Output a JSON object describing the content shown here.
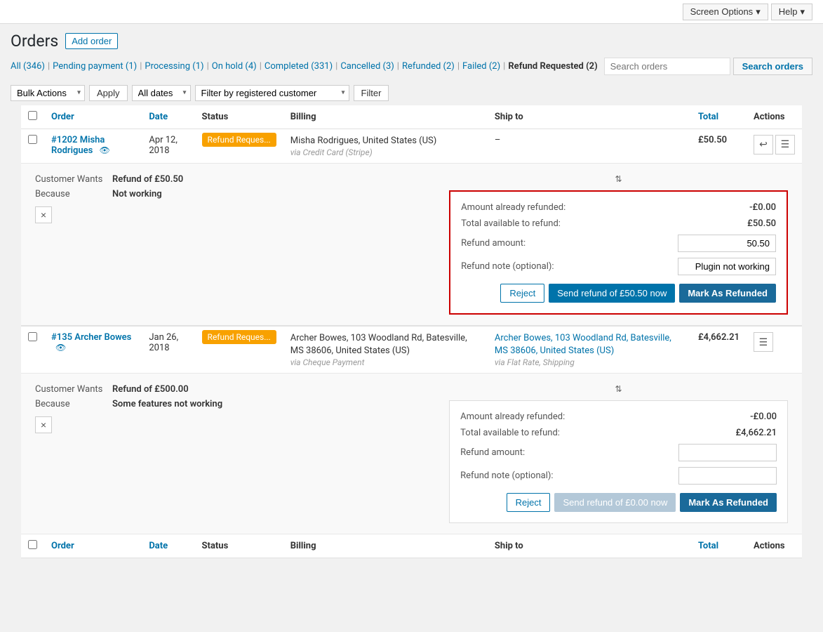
{
  "topbar": {
    "screen_options_label": "Screen Options",
    "help_label": "Help"
  },
  "header": {
    "title": "Orders",
    "add_order_label": "Add order"
  },
  "filter_links": [
    {
      "label": "All",
      "count": "(346)",
      "current": false
    },
    {
      "label": "Pending payment",
      "count": "(1)",
      "current": false
    },
    {
      "label": "Processing",
      "count": "(1)",
      "current": false
    },
    {
      "label": "On hold",
      "count": "(4)",
      "current": false
    },
    {
      "label": "Completed",
      "count": "(331)",
      "current": false
    },
    {
      "label": "Cancelled",
      "count": "(3)",
      "current": false
    },
    {
      "label": "Refunded",
      "count": "(2)",
      "current": false
    },
    {
      "label": "Failed",
      "count": "(2)",
      "current": false
    },
    {
      "label": "Refund Requested",
      "count": "(2)",
      "current": true
    }
  ],
  "search": {
    "placeholder": "Search orders",
    "button_label": "Search orders"
  },
  "toolbar": {
    "bulk_actions_label": "Bulk Actions",
    "apply_label": "Apply",
    "all_dates_label": "All dates",
    "filter_by_customer_placeholder": "Filter by registered customer",
    "filter_label": "Filter"
  },
  "table": {
    "columns": [
      "Order",
      "Date",
      "Status",
      "Billing",
      "Ship to",
      "Total",
      "Actions"
    ]
  },
  "orders": [
    {
      "id": "#1202",
      "name": "Misha Rodrigues",
      "date": "Apr 12, 2018",
      "status": "Refund Reques...",
      "billing": "Misha Rodrigues, United States (US)",
      "billing_via": "via Credit Card (Stripe)",
      "ship_to": "–",
      "total": "£50.50",
      "customer_wants_label": "Customer Wants",
      "customer_wants_value": "Refund of £50.50",
      "because_label": "Because",
      "because_value": "Not working",
      "refund_panel": {
        "highlighted": true,
        "amount_already_refunded_label": "Amount already refunded:",
        "amount_already_refunded_value": "-£0.00",
        "total_available_label": "Total available to refund:",
        "total_available_value": "£50.50",
        "refund_amount_label": "Refund amount:",
        "refund_amount_value": "50.50",
        "refund_note_label": "Refund note (optional):",
        "refund_note_value": "Plugin not working",
        "reject_label": "Reject",
        "send_refund_label": "Send refund of £50.50 now",
        "mark_refunded_label": "Mark As Refunded",
        "send_disabled": false
      }
    },
    {
      "id": "#135",
      "name": "Archer Bowes",
      "date": "Jan 26, 2018",
      "status": "Refund Reques...",
      "billing": "Archer Bowes, 103 Woodland Rd, Batesville, MS 38606, United States (US)",
      "billing_via": "via Cheque Payment",
      "ship_to": "Archer Bowes, 103 Woodland Rd, Batesville, MS 38606, United States (US)",
      "ship_via": "via Flat Rate, Shipping",
      "total": "£4,662.21",
      "customer_wants_label": "Customer Wants",
      "customer_wants_value": "Refund of £500.00",
      "because_label": "Because",
      "because_value": "Some features not working",
      "refund_panel": {
        "highlighted": false,
        "amount_already_refunded_label": "Amount already refunded:",
        "amount_already_refunded_value": "-£0.00",
        "total_available_label": "Total available to refund:",
        "total_available_value": "£4,662.21",
        "refund_amount_label": "Refund amount:",
        "refund_amount_value": "",
        "refund_note_label": "Refund note (optional):",
        "refund_note_value": "",
        "reject_label": "Reject",
        "send_refund_label": "Send refund of £0.00 now",
        "mark_refunded_label": "Mark As Refunded",
        "send_disabled": true
      }
    }
  ]
}
